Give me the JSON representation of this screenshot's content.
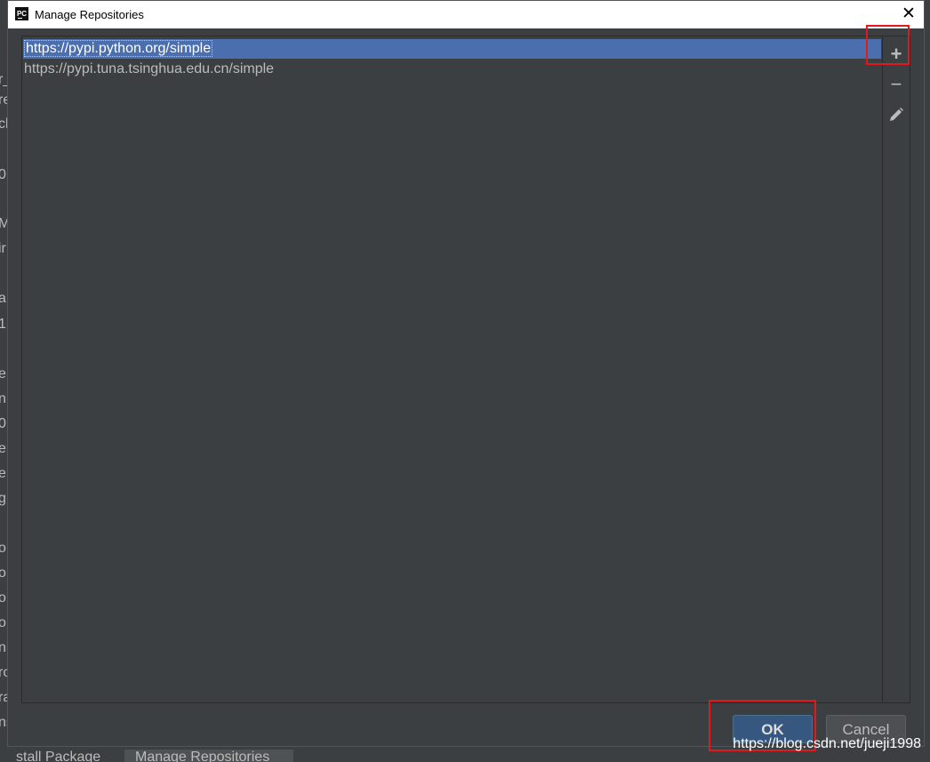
{
  "window": {
    "title": "Manage Repositories",
    "app_icon": "pycharm-logo",
    "app_icon_text": "PC"
  },
  "repositories": [
    {
      "url": "https://pypi.python.org/simple",
      "selected": true
    },
    {
      "url": "https://pypi.tuna.tsinghua.edu.cn/simple",
      "selected": false
    }
  ],
  "toolbar": {
    "add_icon": "plus-icon",
    "add_label": "+",
    "remove_icon": "minus-icon",
    "remove_label": "−",
    "edit_icon": "pencil-icon"
  },
  "buttons": {
    "ok_label": "OK",
    "cancel_label": "Cancel"
  },
  "background": {
    "left_fragments": [
      "r_",
      "re",
      "cl",
      "0",
      "M",
      "ir",
      "a",
      "1",
      "e",
      "n",
      "0",
      "er",
      "er",
      "g",
      "o",
      "o",
      "o",
      "o",
      "ni",
      "ro",
      "ra",
      "ns"
    ],
    "bottom_tabs": [
      "stall Package",
      "Manage Repositories"
    ]
  },
  "watermark": "https://blog.csdn.net/jueji1998",
  "colors": {
    "selection": "#4b6eaf",
    "highlight_box": "#e0191d",
    "ok_button": "#365880"
  }
}
